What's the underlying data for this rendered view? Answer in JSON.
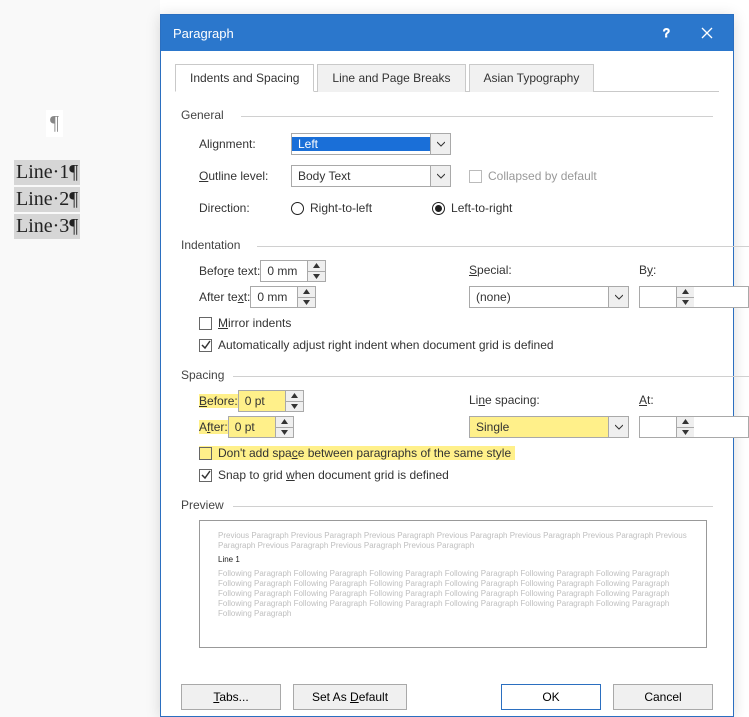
{
  "document": {
    "lines": [
      "Line·1¶",
      "Line·2¶",
      "Line·3¶"
    ],
    "pilcrow": "¶"
  },
  "dialog": {
    "title": "Paragraph",
    "tabs": {
      "indents": "Indents and Spacing",
      "breaks": "Line and Page Breaks",
      "asian": "Asian Typography"
    },
    "general": {
      "legend": "General",
      "alignment_label": "Alignment:",
      "alignment_value": "Left",
      "outline_label": "Outline level:",
      "outline_value": "Body Text",
      "collapsed_label": "Collapsed by default",
      "direction_label": "Direction:",
      "rtl_label": "Right-to-left",
      "ltr_label": "Left-to-right"
    },
    "indentation": {
      "legend": "Indentation",
      "before_label": "Before text:",
      "before_value": "0 mm",
      "after_label": "After text:",
      "after_value": "0 mm",
      "special_label": "Special:",
      "special_value": "(none)",
      "by_label": "By:",
      "by_value": "",
      "mirror_label": "Mirror indents",
      "auto_label": "Automatically adjust right indent when document grid is defined"
    },
    "spacing": {
      "legend": "Spacing",
      "before_label": "Before:",
      "before_value": "0 pt",
      "after_label": "After:",
      "after_value": "0 pt",
      "line_label": "Line spacing:",
      "line_value": "Single",
      "at_label": "At:",
      "at_value": "",
      "dont_add_label": "Don't add space between paragraphs of the same style",
      "snap_label": "Snap to grid when document grid is defined"
    },
    "preview": {
      "legend": "Preview",
      "prev_text": "Previous Paragraph Previous Paragraph Previous Paragraph Previous Paragraph Previous Paragraph Previous Paragraph Previous Paragraph Previous Paragraph Previous Paragraph Previous Paragraph",
      "main_text": "Line 1",
      "follow_text": "Following Paragraph Following Paragraph Following Paragraph Following Paragraph Following Paragraph Following Paragraph Following Paragraph Following Paragraph Following Paragraph Following Paragraph Following Paragraph Following Paragraph Following Paragraph Following Paragraph Following Paragraph Following Paragraph Following Paragraph Following Paragraph Following Paragraph Following Paragraph Following Paragraph Following Paragraph Following Paragraph Following Paragraph Following Paragraph"
    },
    "buttons": {
      "tabs": "Tabs...",
      "default": "Set As Default",
      "ok": "OK",
      "cancel": "Cancel"
    }
  }
}
